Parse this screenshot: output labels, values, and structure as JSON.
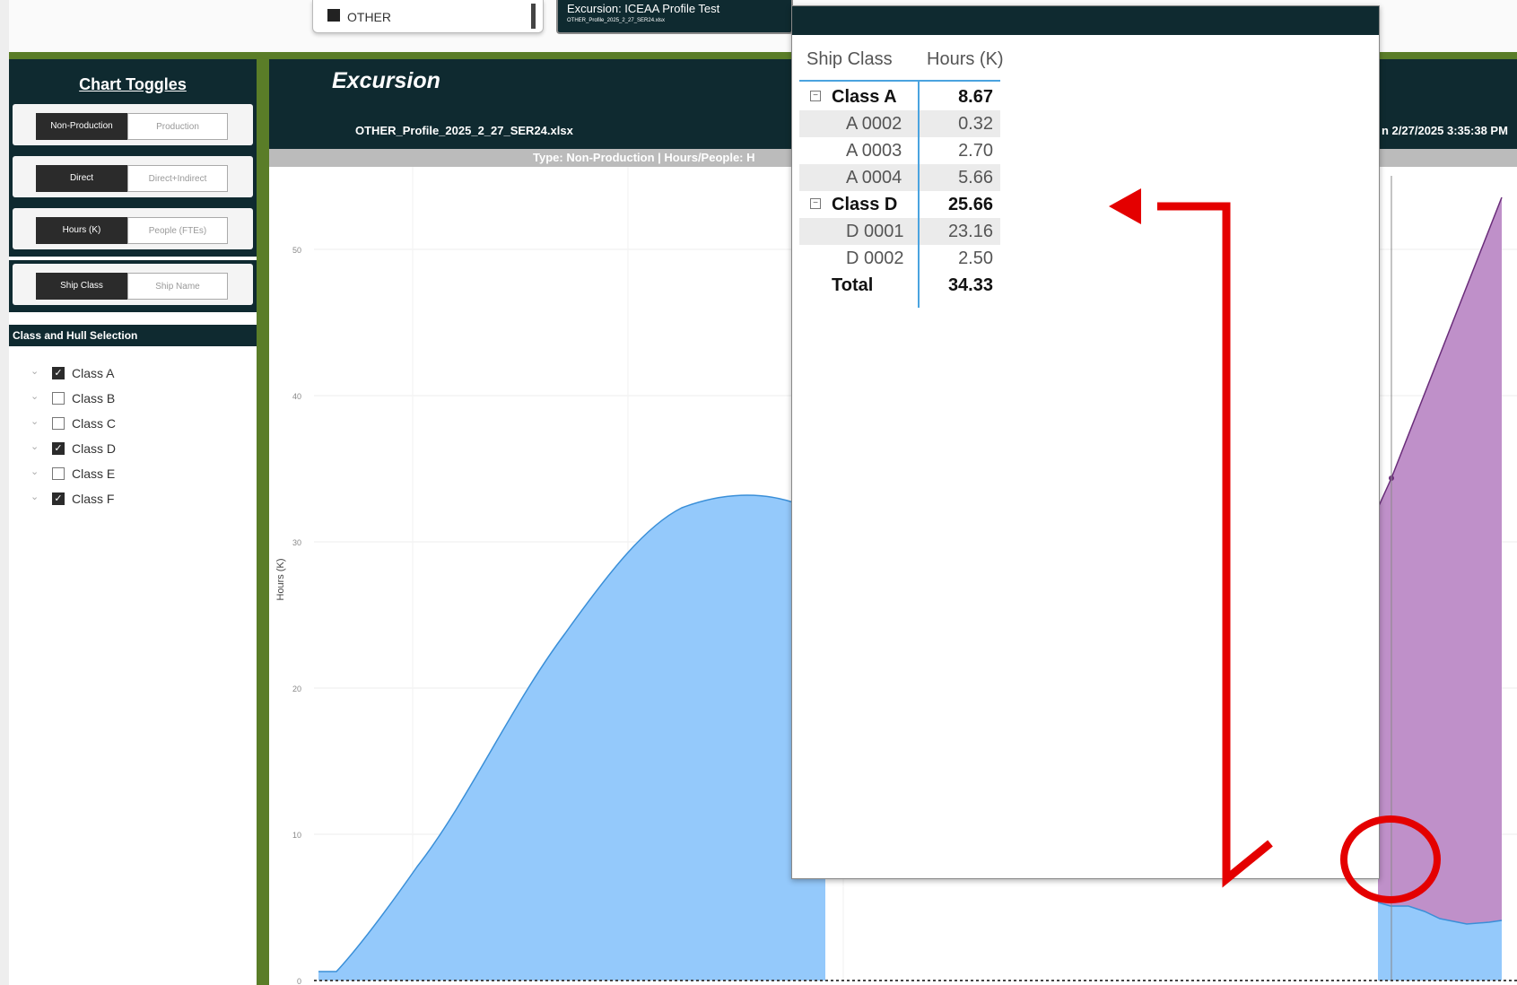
{
  "top_legend": {
    "label": "OTHER"
  },
  "report_card": {
    "title": "Excursion: ICEAA Profile Test",
    "file": "OTHER_Profile_2025_2_27_SER24.xlsx"
  },
  "left_panel": {
    "title": "Chart Toggles",
    "toggles": [
      {
        "on": "Non-Production",
        "off": "Production"
      },
      {
        "on": "Direct",
        "off": "Direct+Indirect"
      },
      {
        "on": "Hours (K)",
        "off": "People (FTEs)"
      },
      {
        "on": "Ship Class",
        "off": "Ship Name"
      }
    ],
    "selection_header": "Class and Hull Selection",
    "classes": [
      {
        "label": "Class A",
        "checked": true
      },
      {
        "label": "Class B",
        "checked": false
      },
      {
        "label": "Class C",
        "checked": false
      },
      {
        "label": "Class D",
        "checked": true
      },
      {
        "label": "Class E",
        "checked": false
      },
      {
        "label": "Class F",
        "checked": true
      }
    ]
  },
  "main": {
    "title": "Excursion",
    "file": "OTHER_Profile_2025_2_27_SER24.xlsx",
    "date_text": "n 2/27/2025 3:35:38 PM",
    "subtitle": "Type: Non-Production | Hours/People: H"
  },
  "chart_data": {
    "type": "area",
    "ylabel": "Hours (K)",
    "yticks": [
      0,
      10,
      20,
      30,
      40,
      50
    ],
    "colors": {
      "blue": "#94c9fb",
      "blue_line": "#3a8fd8",
      "purple": "#bf90c9",
      "purple_line": "#6a2d7a"
    }
  },
  "tooltip": {
    "col1": "Ship Class",
    "col2": "Hours (K)",
    "rows": [
      {
        "name": "Class A",
        "value": "8.67",
        "kind": "group"
      },
      {
        "name": "A 0002",
        "value": "0.32",
        "kind": "sub"
      },
      {
        "name": "A 0003",
        "value": "2.70",
        "kind": "sub"
      },
      {
        "name": "A 0004",
        "value": "5.66",
        "kind": "sub"
      },
      {
        "name": "Class D",
        "value": "25.66",
        "kind": "group"
      },
      {
        "name": "D 0001",
        "value": "23.16",
        "kind": "sub"
      },
      {
        "name": "D 0002",
        "value": "2.50",
        "kind": "sub"
      },
      {
        "name": "Total",
        "value": "34.33",
        "kind": "total"
      }
    ]
  }
}
